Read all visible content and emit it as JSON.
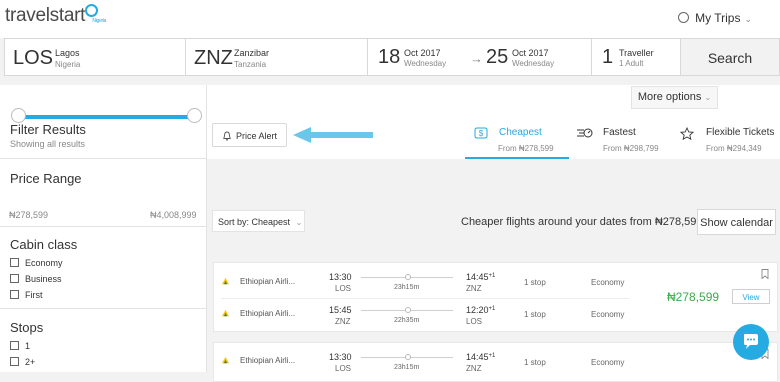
{
  "header": {
    "logo": "travelstart",
    "logo_sub": "Nigeria",
    "my_trips": "My Trips"
  },
  "search": {
    "from_code": "LOS",
    "from_city": "Lagos",
    "from_country": "Nigeria",
    "to_code": "ZNZ",
    "to_city": "Zanzibar",
    "to_country": "Tanzania",
    "depart_day": "18",
    "depart_monthyear": "Oct 2017",
    "depart_weekday": "Wednesday",
    "return_day": "25",
    "return_monthyear": "Oct 2017",
    "return_weekday": "Wednesday",
    "travellers_count": "1",
    "travellers_label": "Traveller",
    "travellers_detail": "1 Adult",
    "search_button": "Search"
  },
  "filters": {
    "title": "Filter Results",
    "subtitle": "Showing all results",
    "price_range": {
      "title": "Price Range",
      "min": "₦278,599",
      "max": "₦4,008,999",
      "low_fraction": 0.0,
      "high_fraction": 1.0
    },
    "cabin_class": {
      "title": "Cabin class",
      "options": [
        "Economy",
        "Business",
        "First"
      ]
    },
    "stops": {
      "title": "Stops",
      "options": [
        "1",
        "2+"
      ]
    }
  },
  "toolbar": {
    "more_options": "More options",
    "price_alert": "Price Alert",
    "tabs": [
      {
        "label": "Cheapest",
        "price": "From ₦278,599",
        "active": true,
        "icon": "dollar-tag-icon"
      },
      {
        "label": "Fastest",
        "price": "From ₦298,799",
        "active": false,
        "icon": "speed-icon"
      },
      {
        "label": "Flexible Tickets",
        "price": "From ₦294,349",
        "active": false,
        "icon": "star-icon"
      }
    ],
    "sort_label": "Sort by: Cheapest",
    "cheaper_text": "Cheaper flights around your dates from ₦278,599",
    "show_calendar": "Show calendar"
  },
  "results": [
    {
      "price": "₦278,599",
      "view": "View",
      "legs": [
        {
          "airline": "Ethiopian Airli...",
          "dep_time": "13:30",
          "dep_apt": "LOS",
          "duration": "23h15m",
          "arr_time": "14:45",
          "arr_sup": "+1",
          "arr_apt": "ZNZ",
          "stops": "1 stop",
          "cabin": "Economy"
        },
        {
          "airline": "Ethiopian Airli...",
          "dep_time": "15:45",
          "dep_apt": "ZNZ",
          "duration": "22h35m",
          "arr_time": "12:20",
          "arr_sup": "+1",
          "arr_apt": "LOS",
          "stops": "1 stop",
          "cabin": "Economy"
        }
      ]
    },
    {
      "price": "",
      "view": "",
      "legs": [
        {
          "airline": "Ethiopian Airli...",
          "dep_time": "13:30",
          "dep_apt": "LOS",
          "duration": "23h15m",
          "arr_time": "14:45",
          "arr_sup": "+1",
          "arr_apt": "ZNZ",
          "stops": "1 stop",
          "cabin": "Economy"
        }
      ]
    }
  ],
  "colors": {
    "accent": "#25aae1",
    "price": "#3daa4b",
    "annotation_arrow": "#6cc6ea"
  }
}
